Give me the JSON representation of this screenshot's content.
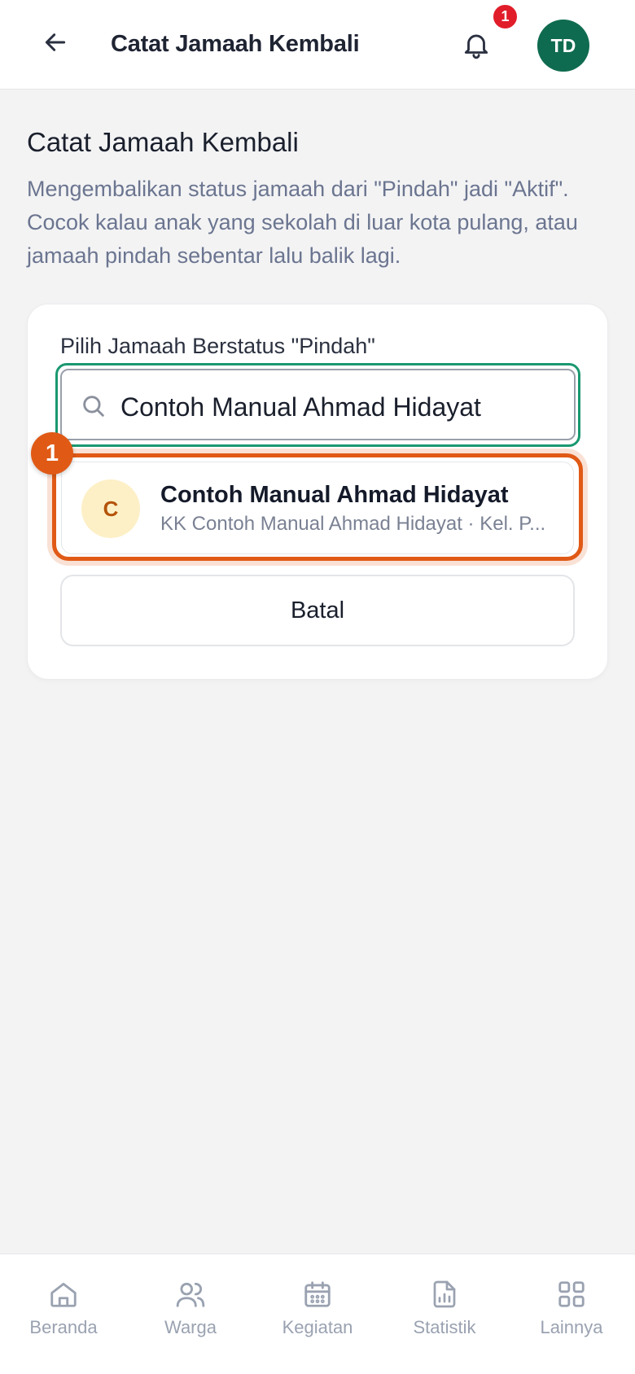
{
  "header": {
    "title": "Catat Jamaah Kembali",
    "notification_count": "1",
    "avatar_initials": "TD"
  },
  "page": {
    "title": "Catat Jamaah Kembali",
    "description": "Mengembalikan status jamaah dari \"Pindah\" jadi \"Aktif\". Cocok kalau anak yang sekolah di luar kota pulang, atau jamaah pindah sebentar lalu balik lagi."
  },
  "form": {
    "label": "Pilih Jamaah Berstatus \"Pindah\"",
    "search_value": "Contoh Manual Ahmad Hidayat",
    "results": [
      {
        "initial": "C",
        "name": "Contoh Manual Ahmad Hidayat",
        "subtitle": "KK Contoh Manual Ahmad Hidayat · Kel. P..."
      }
    ],
    "step_marker": "1",
    "cancel_label": "Batal"
  },
  "nav": {
    "items": [
      {
        "label": "Beranda",
        "icon": "home-icon"
      },
      {
        "label": "Warga",
        "icon": "users-icon"
      },
      {
        "label": "Kegiatan",
        "icon": "calendar-icon"
      },
      {
        "label": "Statistik",
        "icon": "chart-icon"
      },
      {
        "label": "Lainnya",
        "icon": "grid-icon"
      }
    ]
  },
  "colors": {
    "accent_green": "#1a9870",
    "highlight_orange": "#e05a16",
    "avatar_green": "#0f6b4f",
    "badge_red": "#e11d2a"
  }
}
